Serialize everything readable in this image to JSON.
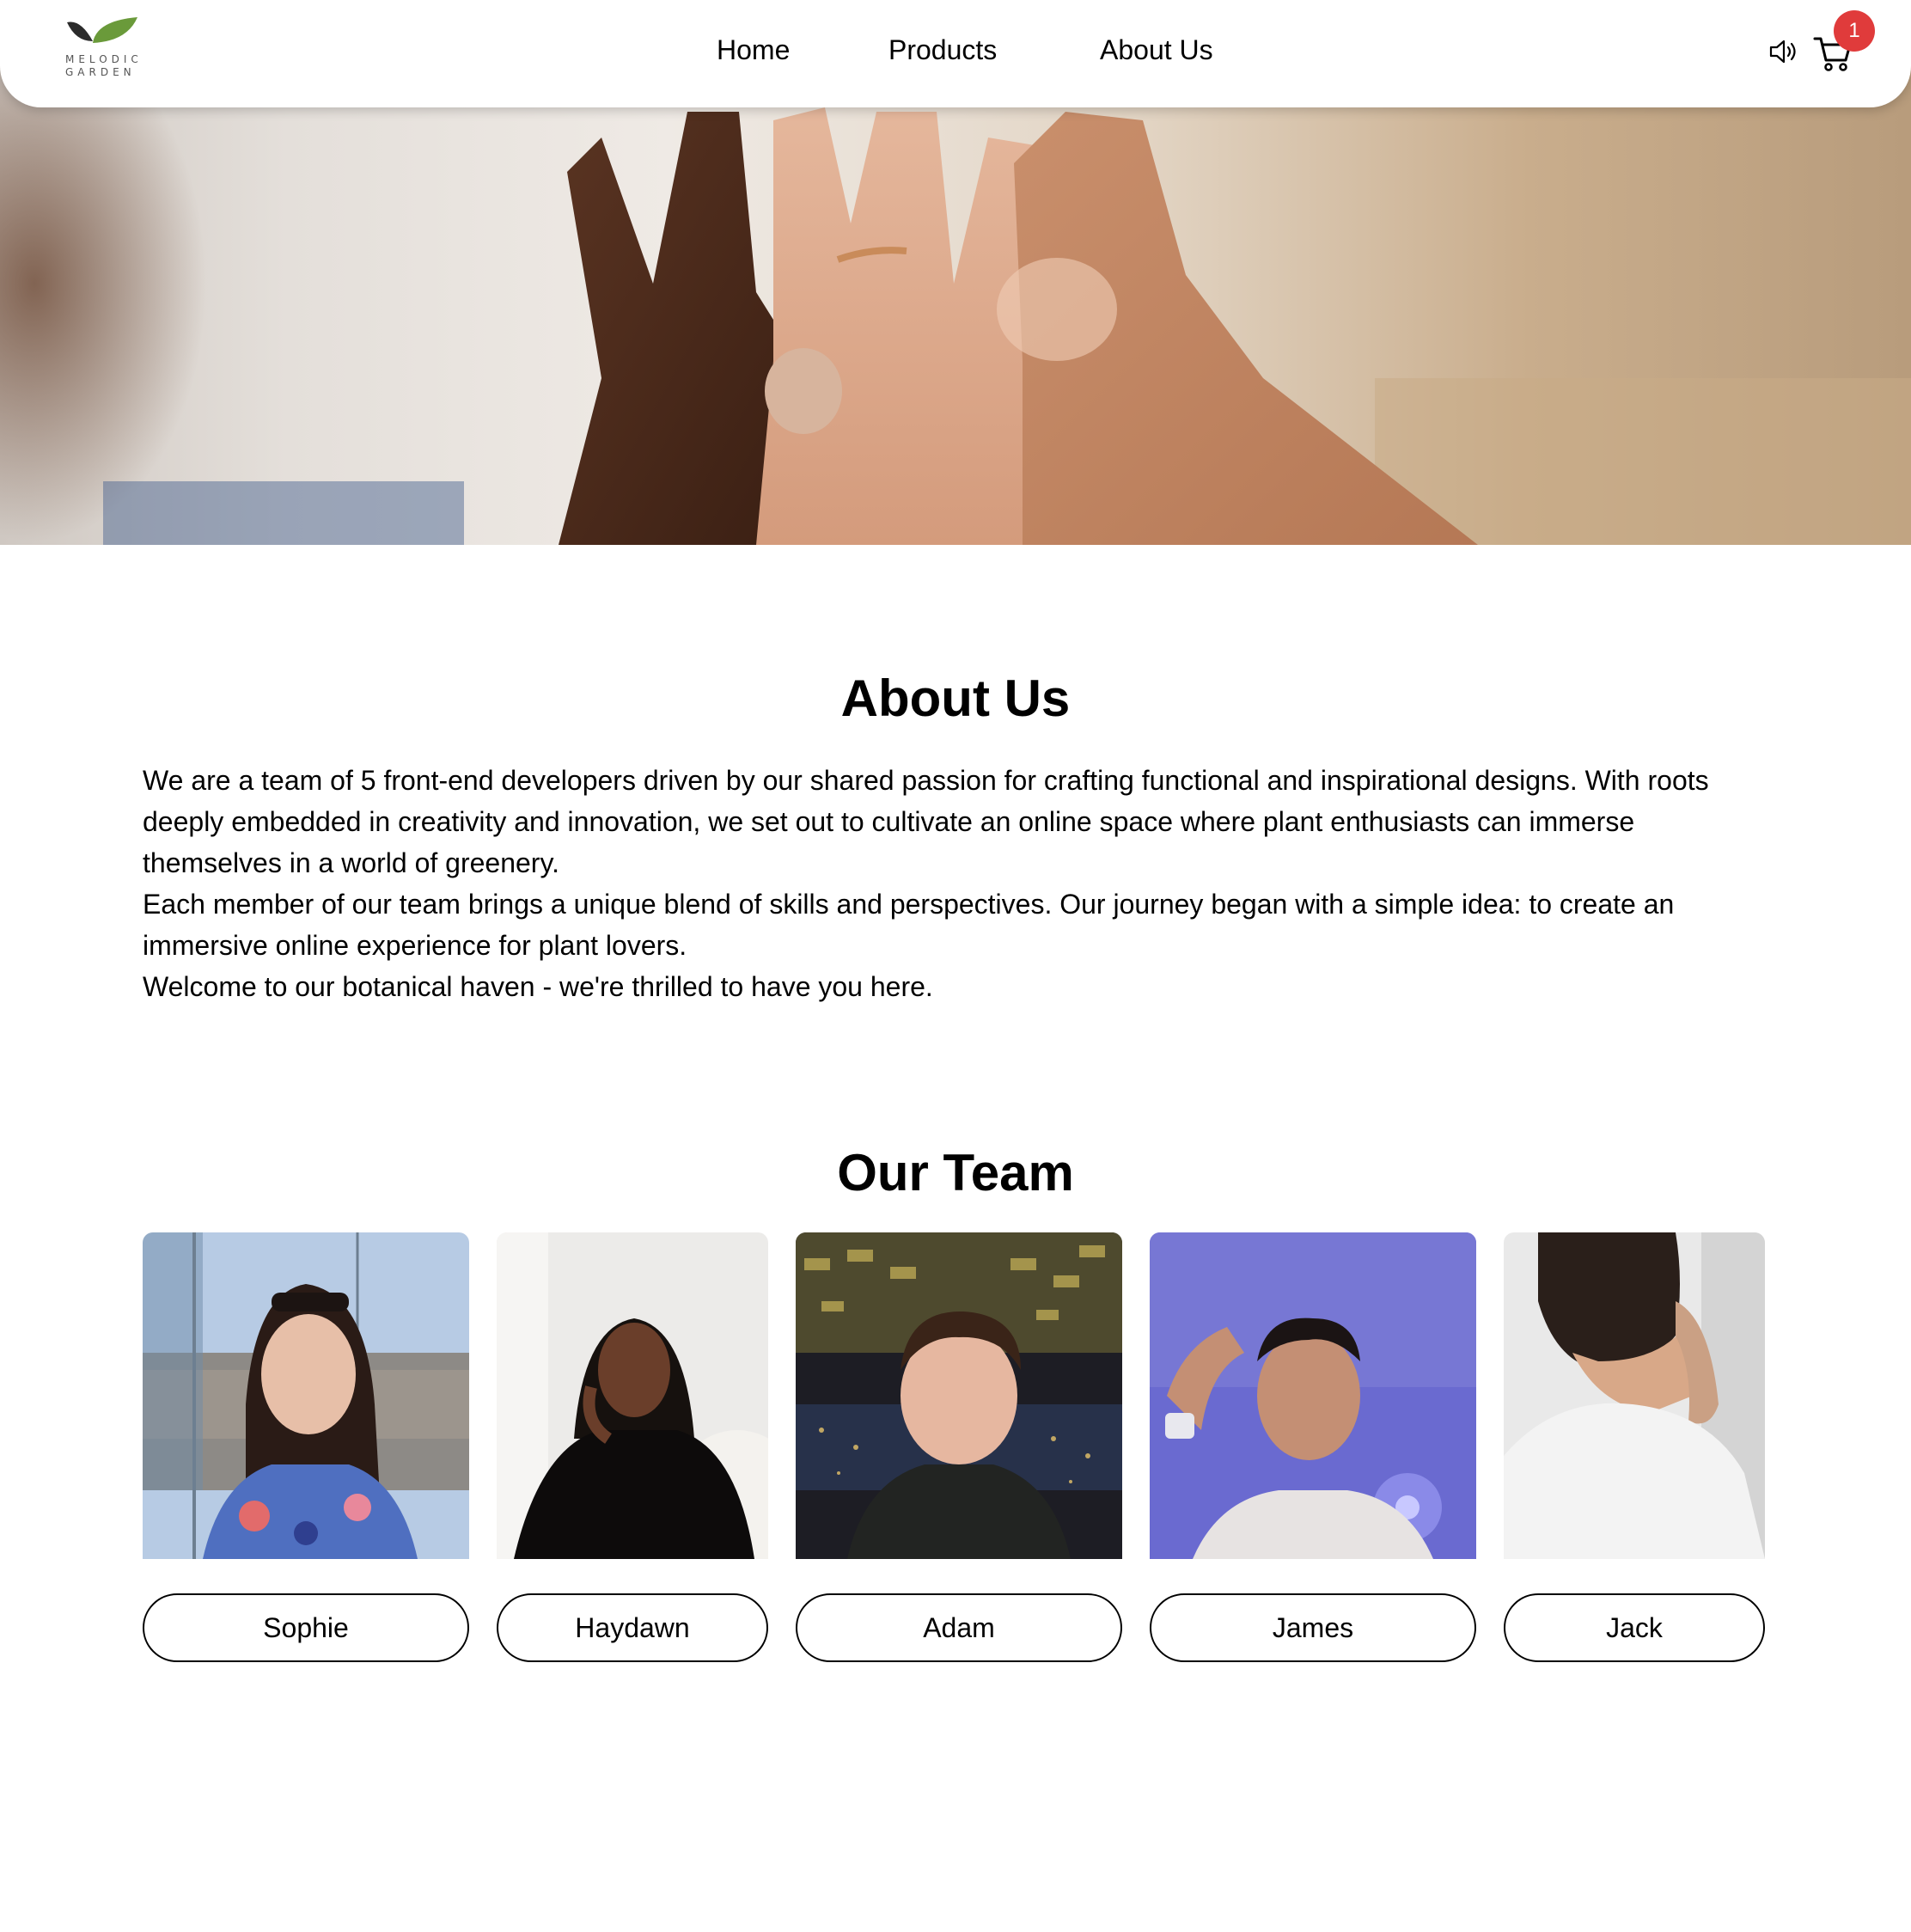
{
  "brand": {
    "line1": "MELODIC",
    "line2": "GARDEN"
  },
  "nav": {
    "home": "Home",
    "products": "Products",
    "about": "About Us"
  },
  "cart": {
    "count": "1"
  },
  "about": {
    "title": "About Us",
    "paragraphs": [
      "We are a team of 5 front-end developers driven by our shared passion for crafting functional and inspirational designs. With roots deeply embedded in creativity and innovation, we set out to cultivate an online space where plant enthusiasts can immerse themselves in a world of greenery.",
      "Each member of our team brings a unique blend of skills and perspectives. Our journey began with a simple idea: to create an immersive online experience for plant lovers.",
      "Welcome to our botanical haven - we're thrilled to have you here."
    ]
  },
  "team": {
    "title": "Our Team",
    "members": [
      {
        "name": "Sophie"
      },
      {
        "name": "Haydawn"
      },
      {
        "name": "Adam"
      },
      {
        "name": "James"
      },
      {
        "name": "Jack"
      }
    ]
  },
  "colors": {
    "badge": "#e03b3b",
    "leaf_dark": "#2b2b2b",
    "leaf_green": "#6a9a3a"
  },
  "icons": {
    "sound": "speaker-icon",
    "cart": "shopping-cart-icon"
  }
}
